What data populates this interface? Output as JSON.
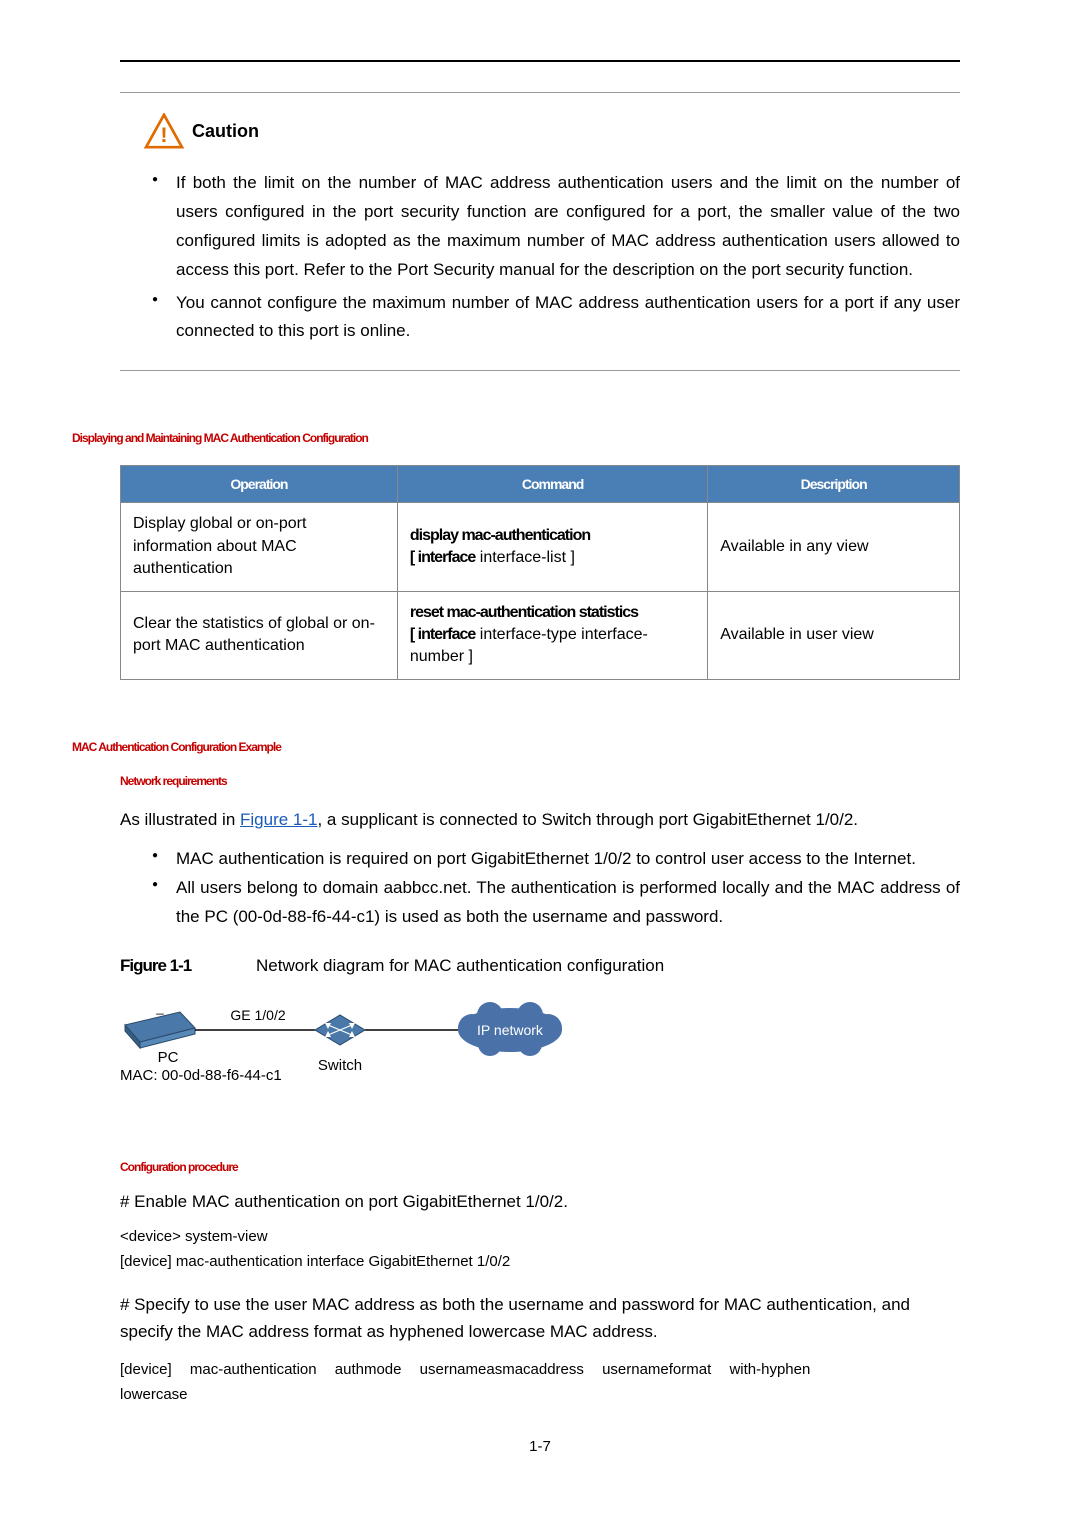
{
  "caution": {
    "label": "Caution",
    "items": [
      "If both the limit on the number of MAC address authentication users and the limit on the number of users configured in the port security function are configured for a port, the smaller value of the two configured limits is adopted as the maximum number of MAC address authentication users allowed to access this port. Refer to the Port Security manual for the description on the port security function.",
      "You cannot configure the maximum number of MAC address authentication users for a port if any user connected to this port is online."
    ]
  },
  "sections": {
    "displaying_heading": "Displaying and Maintaining MAC Authentication Configuration",
    "example_heading": "MAC Authentication Configuration Example",
    "network_req": "Network requirements",
    "config_proc": "Configuration procedure"
  },
  "table": {
    "headers": {
      "operation": "Operation",
      "command": "Command",
      "description": "Description"
    },
    "rows": [
      {
        "op": "Display global or on-port information about MAC authentication",
        "cmd_bold": "display mac-authentication",
        "cmd_open": "[ interface",
        "cmd_rest": " interface-list ]",
        "desc": "Available in any view"
      },
      {
        "op": "Clear the statistics of global or on-port MAC authentication",
        "cmd_bold": "reset mac-authentication statistics",
        "cmd_open": "[ interface",
        "cmd_rest": " interface-type interface-number ]",
        "desc": "Available in user view"
      }
    ]
  },
  "network_req": {
    "intro_prefix": "As illustrated in ",
    "intro_link": "Figure 1-1",
    "intro_suffix": ", a supplicant is connected to Switch through port GigabitEthernet 1/0/2.",
    "items": [
      "MAC authentication is required on port GigabitEthernet 1/0/2 to control user access to the Internet.",
      "All users belong to domain aabbcc.net. The authentication is performed locally and the MAC address of the PC (00-0d-88-f6-44-c1) is used as both the username and password."
    ]
  },
  "figure": {
    "label_bold": "Figure 1-1",
    "label_text": "Network diagram for MAC authentication configuration",
    "ge_label": "GE 1/0/2",
    "pc_label": "PC",
    "mac_label": "MAC: 00-0d-88-f6-44-c1",
    "switch_label": "Switch",
    "network_label": "IP network"
  },
  "procedure": {
    "step1": "# Enable MAC authentication on port GigabitEthernet 1/0/2.",
    "code1_line1": "<device> system-view",
    "code1_line2": "[device] mac-authentication interface GigabitEthernet 1/0/2",
    "step2": "# Specify to use the user MAC address as both the username and password for MAC authentication, and specify the MAC address format as hyphened lowercase MAC address.",
    "code2_line1": "[device] mac-authentication authmode usernameasmacaddress usernameformat with-hyphen",
    "code2_line2": "lowercase"
  },
  "page_number": "1-7"
}
